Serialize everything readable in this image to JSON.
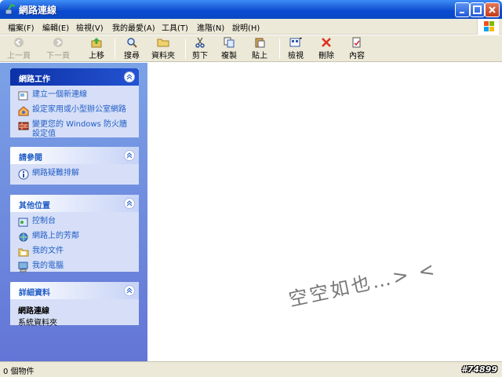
{
  "window": {
    "title": "網路連線",
    "icon": "network-connections-icon"
  },
  "menu": [
    "檔案(F)",
    "編輯(E)",
    "檢視(V)",
    "我的最愛(A)",
    "工具(T)",
    "進階(N)",
    "說明(H)"
  ],
  "toolbar": {
    "back": "上一頁",
    "forward": "下一頁",
    "up": "上移",
    "search": "搜尋",
    "folders": "資料夾",
    "cut": "剪下",
    "copy": "複製",
    "paste": "貼上",
    "views": "檢視",
    "delete": "刪除",
    "properties": "內容"
  },
  "taskpane": {
    "network_tasks": {
      "title": "網路工作",
      "items": [
        "建立一個新連線",
        "設定家用或小型辦公室網路",
        "變更您的 Windows 防火牆設定值"
      ]
    },
    "see_also": {
      "title": "請參閱",
      "items": [
        "網路疑難排解"
      ]
    },
    "other_places": {
      "title": "其他位置",
      "items": [
        "控制台",
        "網路上的芳鄰",
        "我的文件",
        "我的電腦"
      ]
    },
    "details": {
      "title": "詳細資料",
      "name": "網路連線",
      "type": "系統資料夾"
    }
  },
  "content": {
    "handwriting": "空空如也…> <"
  },
  "statusbar": {
    "text": "0 個物件",
    "watermark": "#74899"
  },
  "colors": {
    "title_blue": "#0a4ad0",
    "pane_blue": "#6375d6",
    "link_blue": "#215dc6",
    "chrome": "#ece9d8"
  }
}
